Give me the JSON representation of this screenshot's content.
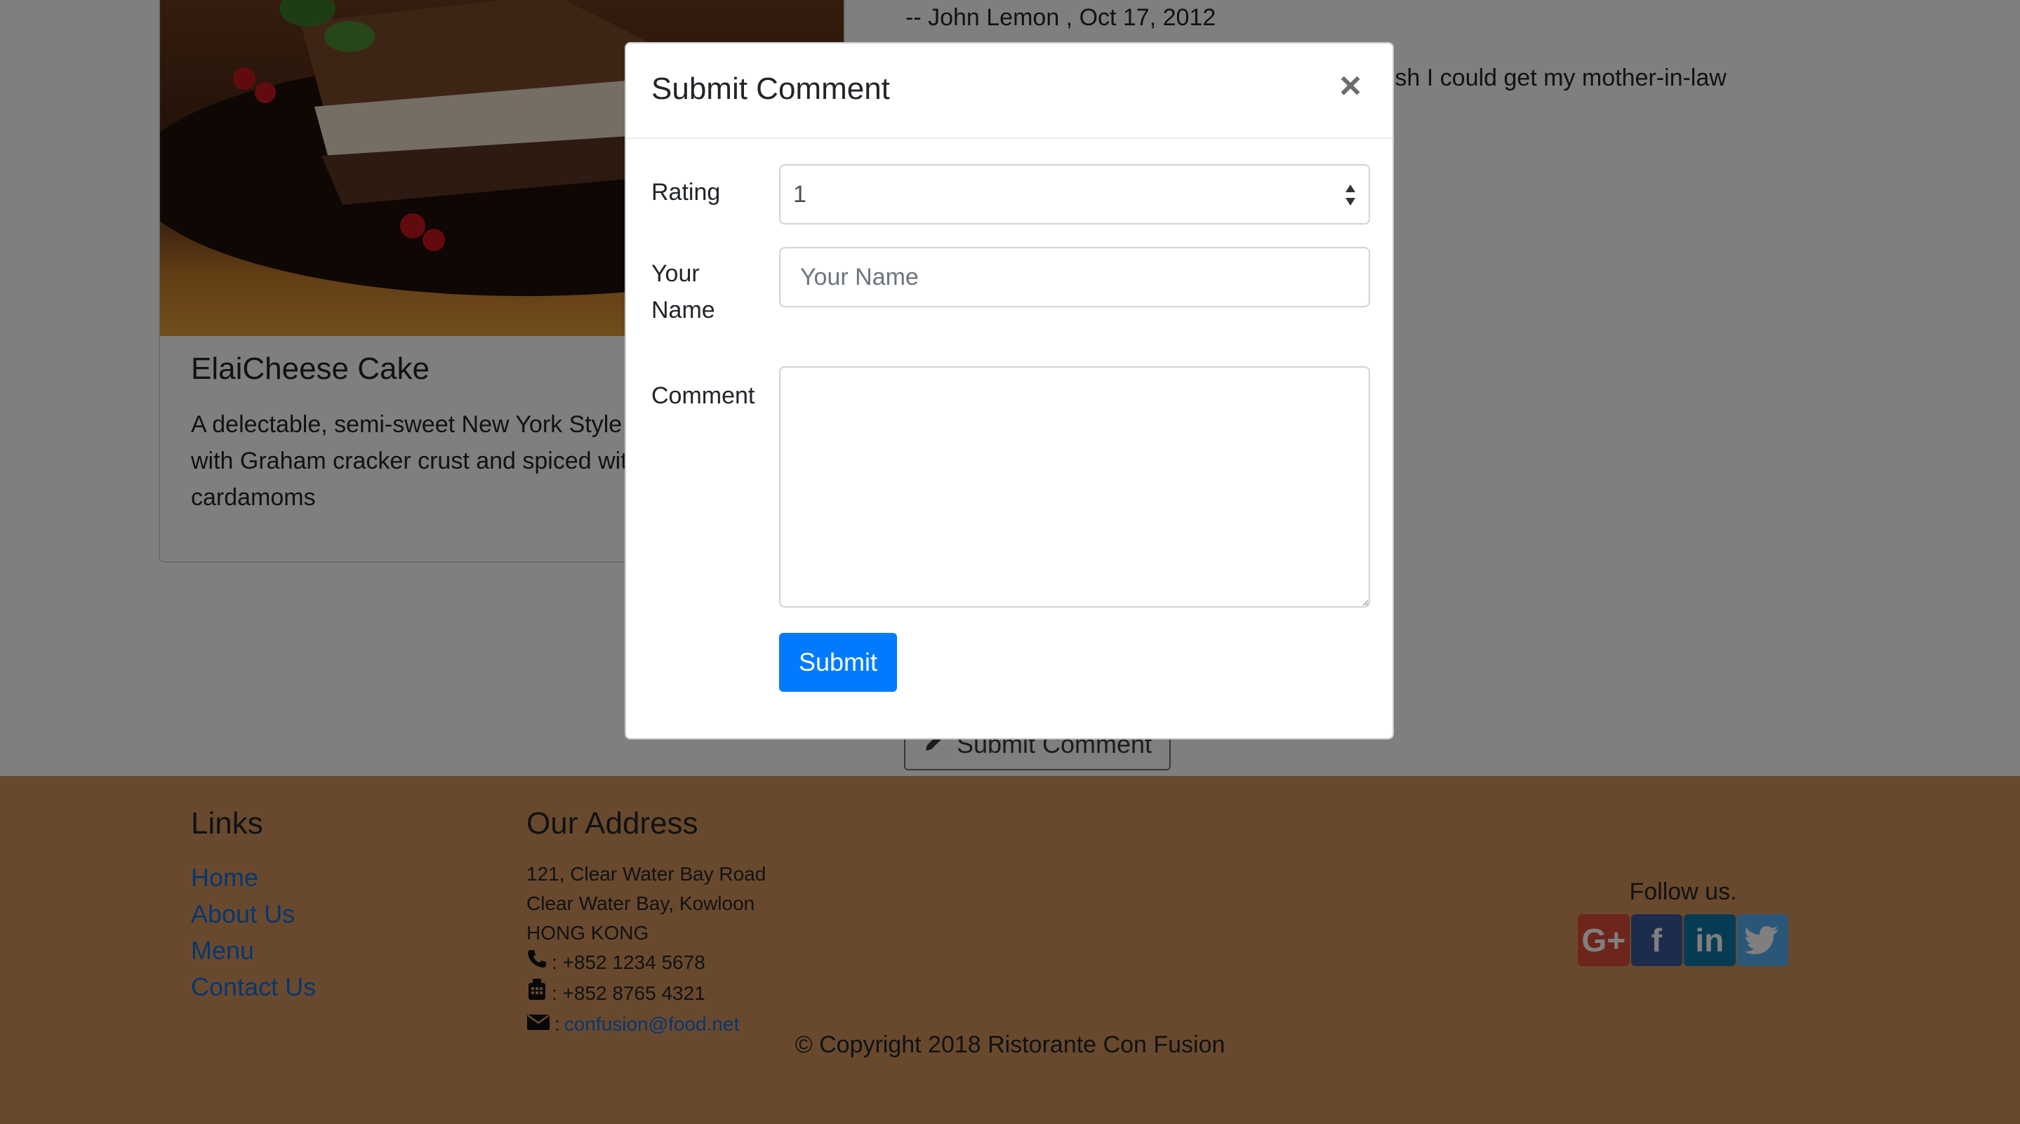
{
  "dish": {
    "title": "ElaiCheese Cake",
    "description": "A delectable, semi-sweet New York Style Cheese Cake, with Graham cracker crust and spiced with Indian cardamoms"
  },
  "comments": {
    "author_line": "-- John Lemon , Oct 17, 2012",
    "text": "Eat it, just eat it! Sends anyone to heaven, I wish I could get my mother-in-law"
  },
  "open_comment_button": {
    "label": "Submit Comment",
    "icon": "pencil-icon"
  },
  "modal": {
    "title": "Submit Comment",
    "close_glyph": "×",
    "rating": {
      "label": "Rating",
      "value": "1"
    },
    "name": {
      "label": "Your Name",
      "placeholder": "Your Name",
      "value": ""
    },
    "comment": {
      "label": "Comment",
      "value": ""
    },
    "submit_label": "Submit"
  },
  "footer": {
    "links_heading": "Links",
    "links": [
      "Home",
      "About Us",
      "Menu",
      "Contact Us"
    ],
    "address_heading": "Our Address",
    "address_lines": [
      "121, Clear Water Bay Road",
      "Clear Water Bay, Kowloon",
      "HONG KONG"
    ],
    "phone": ": +852 1234 5678",
    "fax": ": +852 8765 4321",
    "email_prefix": ":",
    "email": "confusion@food.net",
    "follow_label": "Follow us.",
    "social": [
      "google-plus-icon",
      "facebook-icon",
      "linkedin-icon",
      "twitter-icon"
    ],
    "copyright": "© Copyright 2018 Ristorante Con Fusion"
  },
  "colors": {
    "primary": "#007bff",
    "footer_bg": "#d3935a",
    "link": "#0d6ee0",
    "backdrop": "rgba(0,0,0,0.5)"
  }
}
